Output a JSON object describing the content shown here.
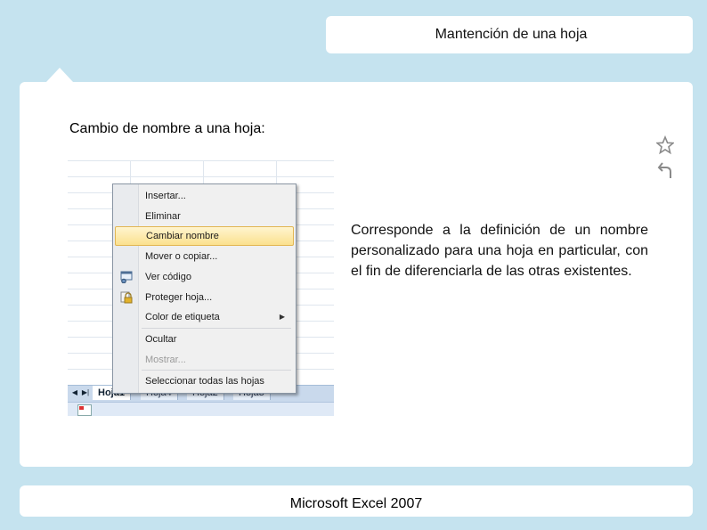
{
  "header": {
    "title": "Mantención de una hoja"
  },
  "section": {
    "heading": "Cambio de nombre a una hoja:"
  },
  "description": "Corresponde a la definición de un nombre personalizado para una hoja en particular, con el fin de diferenciarla de las otras existentes.",
  "icons": {
    "star": "star-icon",
    "undo": "undo-icon"
  },
  "excel": {
    "context_menu": {
      "items": [
        {
          "label": "Insertar..."
        },
        {
          "label": "Eliminar"
        },
        {
          "label": "Cambiar nombre",
          "highlighted": true
        },
        {
          "label": "Mover o copiar..."
        },
        {
          "label": "Ver código",
          "icon": "code-view-icon"
        },
        {
          "label": "Proteger hoja...",
          "icon": "lock-icon"
        },
        {
          "label": "Color de etiqueta",
          "submenu": true
        },
        {
          "label": "Ocultar"
        },
        {
          "label": "Mostrar...",
          "disabled": true
        },
        {
          "label": "Seleccionar todas las hojas"
        }
      ]
    },
    "tabs": [
      "Hoja1",
      "Hoja4",
      "Hoja2",
      "Hoja3"
    ],
    "active_tab": "Hoja1"
  },
  "footer": {
    "text": "Microsoft Excel 2007"
  },
  "colors": {
    "background": "#c5e3ef",
    "highlight": "#fbe18e"
  }
}
